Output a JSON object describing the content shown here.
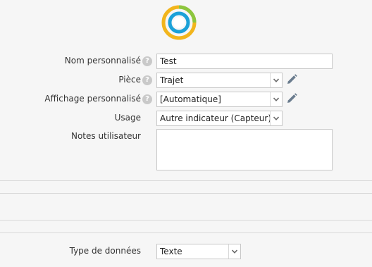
{
  "form": {
    "custom_name_label": "Nom personnalisé",
    "custom_name_value": "Test",
    "room_label": "Pièce",
    "room_value": "Trajet",
    "custom_display_label": "Affichage personnalisé",
    "custom_display_value": "[Automatique]",
    "usage_label": "Usage",
    "usage_value": "Autre indicateur (Capteur)",
    "notes_label": "Notes utilisateur",
    "notes_value": "",
    "data_type_label": "Type de données",
    "data_type_value": "Texte"
  },
  "help_glyph": "?",
  "colors": {
    "logo_yellow": "#f2b51c",
    "logo_green": "#8cc63f",
    "logo_blue": "#1ba1d8",
    "pencil": "#6a7c8e",
    "help_icon": "#c9c9c9"
  }
}
